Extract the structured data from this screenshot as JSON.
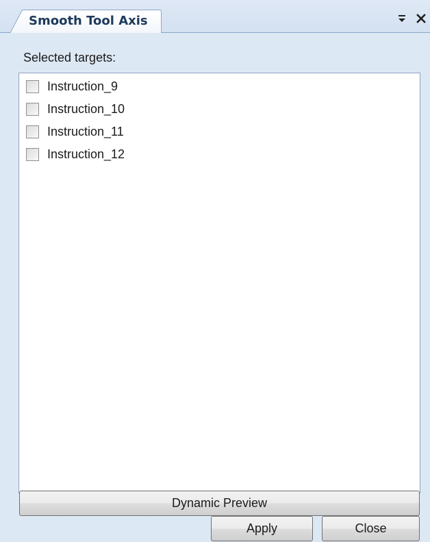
{
  "window": {
    "tab_title": "Smooth Tool Axis",
    "pin_icon": "dropdown-pin-icon",
    "close_icon": "close-icon"
  },
  "main": {
    "selected_label": "Selected targets:",
    "targets": [
      {
        "label": "Instruction_9",
        "checked": false
      },
      {
        "label": "Instruction_10",
        "checked": false
      },
      {
        "label": "Instruction_11",
        "checked": false
      },
      {
        "label": "Instruction_12",
        "checked": false
      }
    ]
  },
  "buttons": {
    "preview": "Dynamic Preview",
    "apply": "Apply",
    "close": "Close"
  },
  "colors": {
    "panel_bg": "#dde8f5",
    "tab_text": "#1e395b",
    "border": "#8da2bd"
  }
}
